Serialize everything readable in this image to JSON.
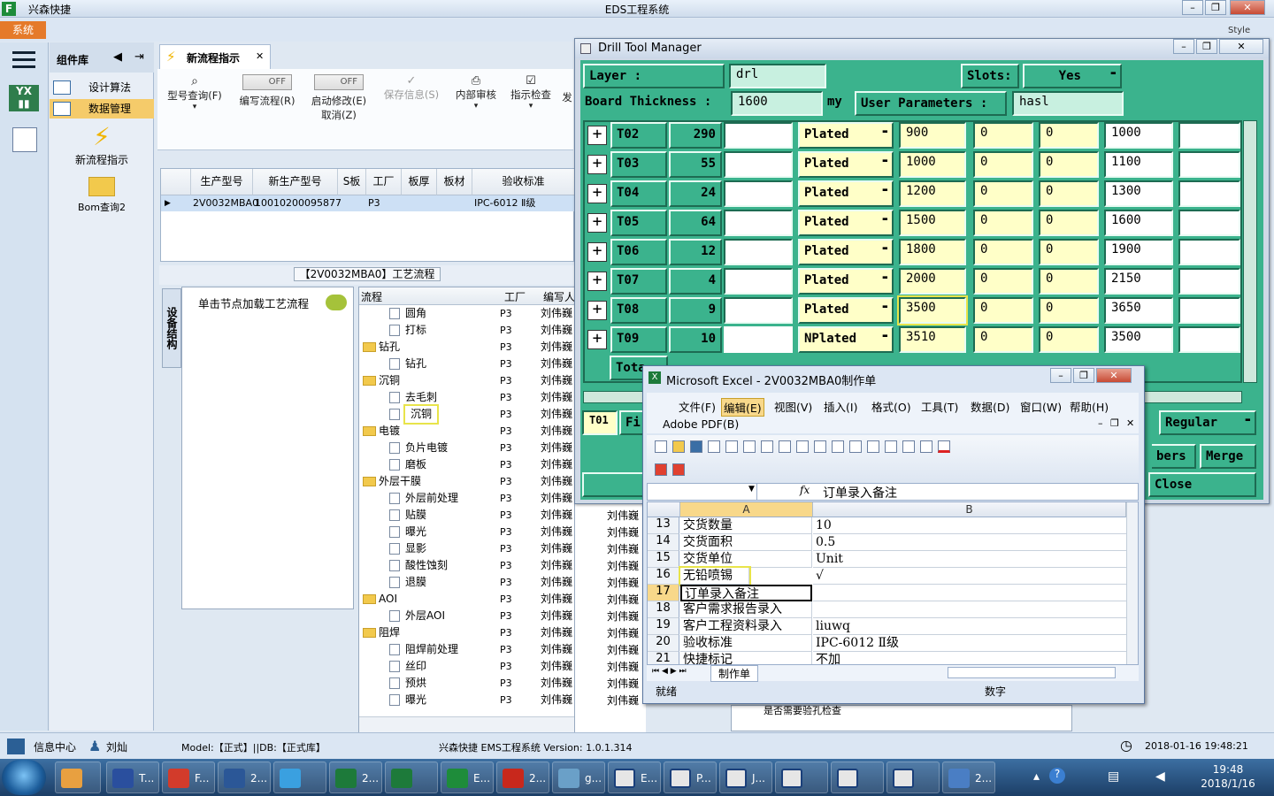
{
  "app": {
    "name": "兴森快捷",
    "title": "EDS工程系统",
    "system_menu": "系统",
    "style_label": "Style"
  },
  "left_panel": {
    "header": "组件库",
    "items": [
      {
        "label": "设计算法",
        "selected": false
      },
      {
        "label": "数据管理",
        "selected": true
      }
    ],
    "tiles": [
      {
        "label": "新流程指示",
        "icon": "lightning-icon"
      },
      {
        "label": "Bom查询2",
        "icon": "folder-icon"
      }
    ]
  },
  "main_tab": {
    "label": "新流程指示"
  },
  "toolbar": {
    "type_query": "型号查询(F)",
    "edit_flow": "编写流程(R)",
    "enable_edit": "启动修改(E)",
    "cancel": "取消(Z)",
    "toggle_off": "OFF",
    "save_info": "保存信息(S)",
    "internal_review": "内部审核",
    "instruction_check": "指示检查",
    "more": "发"
  },
  "grid": {
    "columns": [
      "生产型号",
      "新生产型号",
      "S板",
      "工厂",
      "板厚",
      "板材",
      "验收标准"
    ],
    "rows": [
      {
        "model": "2V0032MBA0",
        "new_model": "10010200095877",
        "factory": "P3",
        "standard": "IPC-6012 Ⅱ级"
      }
    ]
  },
  "process": {
    "caption": "【2V0032MBA0】工艺流程",
    "side_tab": "设备结构",
    "hint": "单击节点加载工艺流程",
    "tree_header": [
      "流程",
      "工厂",
      "编写人"
    ],
    "tree_rows": [
      {
        "name": "圆角",
        "level": 2,
        "folder": false,
        "factory": "P3",
        "writer": "刘伟巍"
      },
      {
        "name": "打标",
        "level": 2,
        "folder": false,
        "factory": "P3",
        "writer": "刘伟巍"
      },
      {
        "name": "钻孔",
        "level": 1,
        "folder": true,
        "factory": "P3",
        "writer": "刘伟巍"
      },
      {
        "name": "钻孔",
        "level": 2,
        "folder": false,
        "factory": "P3",
        "writer": "刘伟巍"
      },
      {
        "name": "沉铜",
        "level": 1,
        "folder": true,
        "factory": "P3",
        "writer": "刘伟巍"
      },
      {
        "name": "去毛刺",
        "level": 2,
        "folder": false,
        "factory": "P3",
        "writer": "刘伟巍"
      },
      {
        "name": "沉铜",
        "level": 2,
        "folder": false,
        "factory": "P3",
        "writer": "刘伟巍",
        "highlight": true
      },
      {
        "name": "电镀",
        "level": 1,
        "folder": true,
        "factory": "P3",
        "writer": "刘伟巍"
      },
      {
        "name": "负片电镀",
        "level": 2,
        "folder": false,
        "factory": "P3",
        "writer": "刘伟巍"
      },
      {
        "name": "磨板",
        "level": 2,
        "folder": false,
        "factory": "P3",
        "writer": "刘伟巍"
      },
      {
        "name": "外层干膜",
        "level": 1,
        "folder": true,
        "factory": "P3",
        "writer": "刘伟巍"
      },
      {
        "name": "外层前处理",
        "level": 2,
        "folder": false,
        "factory": "P3",
        "writer": "刘伟巍"
      },
      {
        "name": "贴膜",
        "level": 2,
        "folder": false,
        "factory": "P3",
        "writer": "刘伟巍"
      },
      {
        "name": "曝光",
        "level": 2,
        "folder": false,
        "factory": "P3",
        "writer": "刘伟巍"
      },
      {
        "name": "显影",
        "level": 2,
        "folder": false,
        "factory": "P3",
        "writer": "刘伟巍"
      },
      {
        "name": "酸性蚀刻",
        "level": 2,
        "folder": false,
        "factory": "P3",
        "writer": "刘伟巍"
      },
      {
        "name": "退膜",
        "level": 2,
        "folder": false,
        "factory": "P3",
        "writer": "刘伟巍"
      },
      {
        "name": "AOI",
        "level": 1,
        "folder": true,
        "factory": "P3",
        "writer": "刘伟巍"
      },
      {
        "name": "外层AOI",
        "level": 2,
        "folder": false,
        "factory": "P3",
        "writer": "刘伟巍"
      },
      {
        "name": "阻焊",
        "level": 1,
        "folder": true,
        "factory": "P3",
        "writer": "刘伟巍"
      },
      {
        "name": "阻焊前处理",
        "level": 2,
        "folder": false,
        "factory": "P3",
        "writer": "刘伟巍"
      },
      {
        "name": "丝印",
        "level": 2,
        "folder": false,
        "factory": "P3",
        "writer": "刘伟巍"
      },
      {
        "name": "预烘",
        "level": 2,
        "folder": false,
        "factory": "P3",
        "writer": "刘伟巍"
      },
      {
        "name": "曝光",
        "level": 2,
        "folder": false,
        "factory": "P3",
        "writer": "刘伟巍"
      }
    ],
    "second_writer_col": "刘伟巍",
    "bottom_right_text": "是否需要验孔检查"
  },
  "statusbar": {
    "info_center": "信息中心",
    "user": "刘灿",
    "model_db": "Model:【正式】||DB:【正式库】",
    "version": "兴森快捷 EMS工程系统 Version: 1.0.1.314",
    "datetime": "2018-01-16 19:48:21"
  },
  "drill": {
    "title": "Drill Tool Manager",
    "layer_label": "Layer             :",
    "layer_value": "drl",
    "slots_label": "Slots:",
    "slots_value": "Yes",
    "thickness_label": "Board Thickness :",
    "thickness_value": "1600",
    "thickness_unit": "my",
    "user_params_label": "User Parameters :",
    "user_params_value": "hasl",
    "tools": [
      {
        "tool": "T02",
        "count": "290",
        "type": "Plated",
        "c1": "900",
        "c2": "0",
        "c3": "0",
        "c4": "1000"
      },
      {
        "tool": "T03",
        "count": "55",
        "type": "Plated",
        "c1": "1000",
        "c2": "0",
        "c3": "0",
        "c4": "1100"
      },
      {
        "tool": "T04",
        "count": "24",
        "type": "Plated",
        "c1": "1200",
        "c2": "0",
        "c3": "0",
        "c4": "1300"
      },
      {
        "tool": "T05",
        "count": "64",
        "type": "Plated",
        "c1": "1500",
        "c2": "0",
        "c3": "0",
        "c4": "1600"
      },
      {
        "tool": "T06",
        "count": "12",
        "type": "Plated",
        "c1": "1800",
        "c2": "0",
        "c3": "0",
        "c4": "1900"
      },
      {
        "tool": "T07",
        "count": "4",
        "type": "Plated",
        "c1": "2000",
        "c2": "0",
        "c3": "0",
        "c4": "2150"
      },
      {
        "tool": "T08",
        "count": "9",
        "type": "Plated",
        "c1": "3500",
        "c2": "0",
        "c3": "0",
        "c4": "3650",
        "highlight": true
      },
      {
        "tool": "T09",
        "count": "10",
        "type": "NPlated",
        "c1": "3510",
        "c2": "0",
        "c3": "0",
        "c4": "3500"
      }
    ],
    "total_label": "Tota",
    "current_tool": "T01",
    "fi_label": "Fi",
    "regular": "Regular",
    "numbers": "bers",
    "merge": "Merge",
    "close": "Close"
  },
  "excel": {
    "title": "Microsoft Excel - 2V0032MBA0制作单",
    "menu": [
      "文件(F)",
      "编辑(E)",
      "视图(V)",
      "插入(I)",
      "格式(O)",
      "工具(T)",
      "数据(D)",
      "窗口(W)",
      "帮助(H)"
    ],
    "adobe": "Adobe PDF(B)",
    "formula_prefix": "fx",
    "formula": "订单录入备注",
    "columns": [
      "A",
      "B"
    ],
    "rows": [
      {
        "n": "13",
        "a": "交货数量",
        "b": "10"
      },
      {
        "n": "14",
        "a": "交货面积",
        "b": "0.5"
      },
      {
        "n": "15",
        "a": "交货单位",
        "b": "Unit"
      },
      {
        "n": "16",
        "a": "无铅喷锡",
        "b": "√",
        "highlight": true
      },
      {
        "n": "17",
        "a": "订单录入备注",
        "b": "",
        "active": true
      },
      {
        "n": "18",
        "a": "客户需求报告录入",
        "b": ""
      },
      {
        "n": "19",
        "a": "客户工程资料录入",
        "b": "liuwq"
      },
      {
        "n": "20",
        "a": "验收标准",
        "b": "IPC-6012 Ⅱ级"
      },
      {
        "n": "21",
        "a": "快捷标记",
        "b": "不加"
      }
    ],
    "sheet_tab": "制作单",
    "status_ready": "就绪",
    "status_num": "数字"
  },
  "taskbar": {
    "items": [
      {
        "label": "T...",
        "icon": "floppy-icon"
      },
      {
        "label": "F...",
        "icon": "app-red-icon"
      },
      {
        "label": "2...",
        "icon": "word-icon"
      },
      {
        "label": "",
        "icon": "ie-icon"
      },
      {
        "label": "2...",
        "icon": "excel-icon"
      },
      {
        "label": "",
        "icon": "excel-icon"
      },
      {
        "label": "E...",
        "icon": "green-f-icon"
      },
      {
        "label": "2...",
        "icon": "pdf-icon"
      },
      {
        "label": "g...",
        "icon": "eye-icon"
      },
      {
        "label": "E...",
        "icon": "xwin-icon"
      },
      {
        "label": "P...",
        "icon": "xwin-icon"
      },
      {
        "label": "J...",
        "icon": "xwin-icon"
      },
      {
        "label": "",
        "icon": "xwin-icon"
      },
      {
        "label": "",
        "icon": "xwin-icon"
      },
      {
        "label": "",
        "icon": "xwin-icon"
      },
      {
        "label": "2...",
        "icon": "text-icon"
      }
    ],
    "time": "19:48",
    "date": "2018/1/16"
  }
}
